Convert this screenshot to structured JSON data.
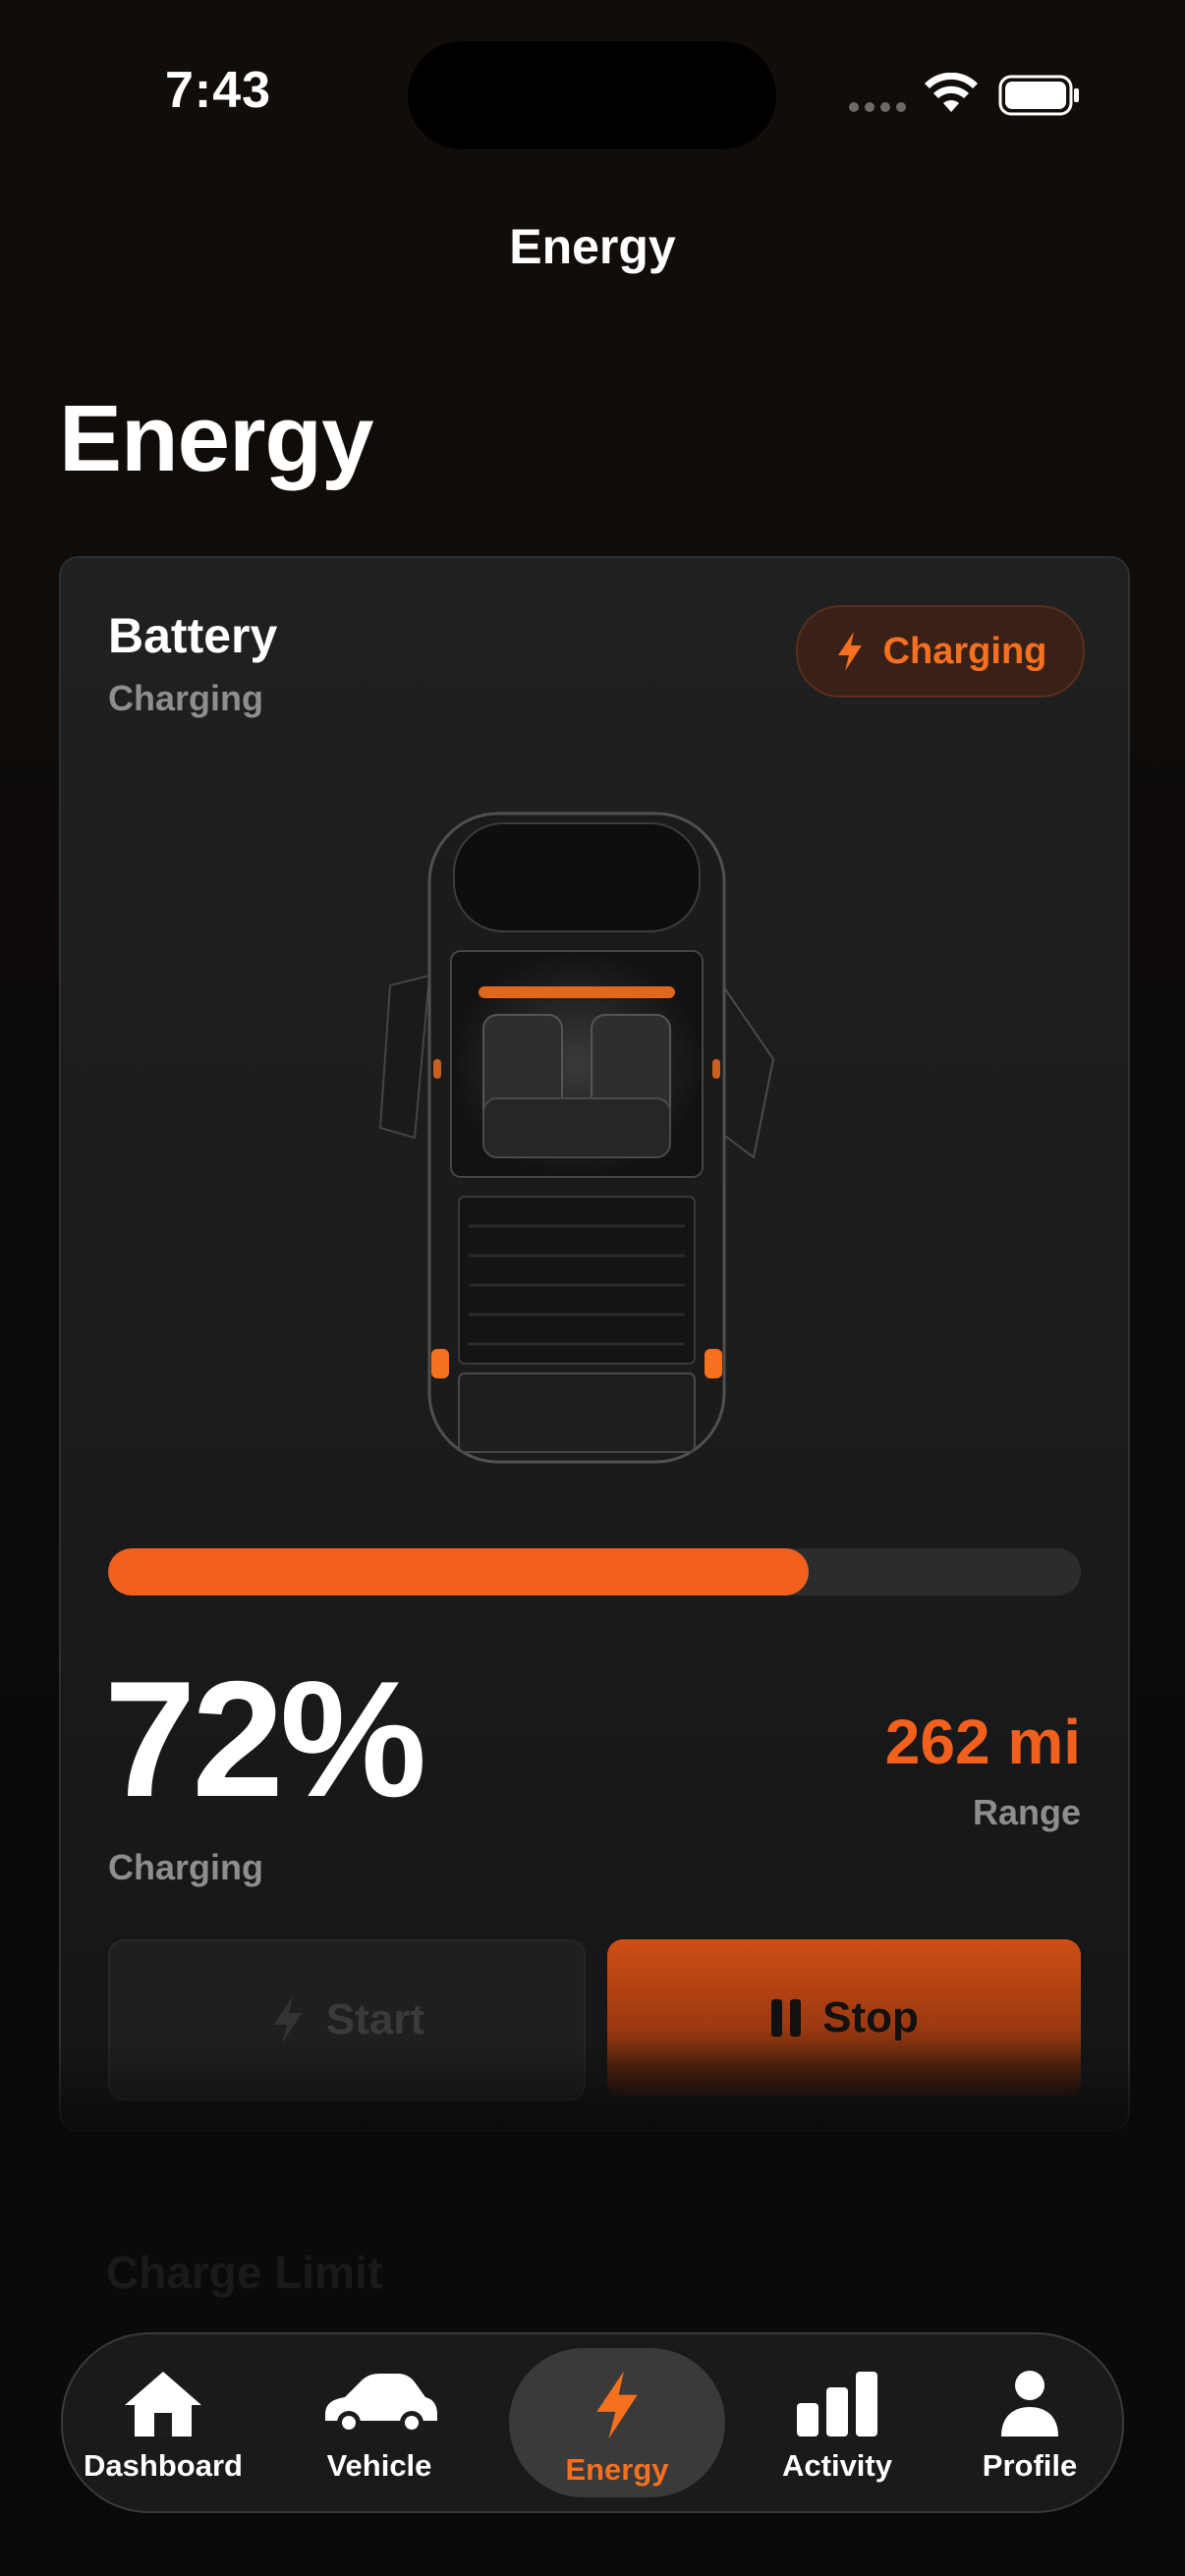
{
  "status": {
    "time": "7:43"
  },
  "nav": {
    "title": "Energy"
  },
  "page": {
    "title": "Energy"
  },
  "battery_card": {
    "title": "Battery",
    "subtitle": "Charging",
    "badge": "Charging",
    "charge_percent": 72,
    "charge_display": "72%",
    "charge_status": "Charging",
    "range_value": "262 mi",
    "range_label": "Range",
    "start_label": "Start",
    "stop_label": "Stop"
  },
  "below_fold": {
    "section_title": "Charge Limit"
  },
  "tabbar": {
    "items": [
      {
        "label": "Dashboard",
        "icon": "house-icon"
      },
      {
        "label": "Vehicle",
        "icon": "car-icon"
      },
      {
        "label": "Energy",
        "icon": "bolt-icon",
        "active": true
      },
      {
        "label": "Activity",
        "icon": "bar-chart-icon"
      },
      {
        "label": "Profile",
        "icon": "person-icon"
      }
    ]
  },
  "colors": {
    "accent": "#f2601e",
    "background": "#0d0b0a",
    "card": "#1f2022"
  }
}
